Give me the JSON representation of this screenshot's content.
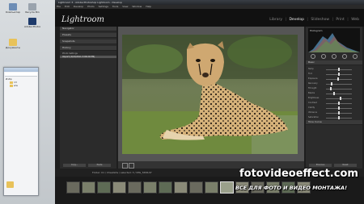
{
  "desktop": {
    "icons": [
      {
        "label": "Компьютер",
        "icon": "computer-icon"
      },
      {
        "label": "Recycle Bin",
        "icon": "recycle-bin-icon"
      },
      {
        "label": "Adobe Photoshop",
        "icon": "photoshop-icon"
      },
      {
        "label": "Документы",
        "icon": "documents-icon"
      }
    ]
  },
  "explorer": {
    "rows": [
      "Избр",
      "13",
      "ww"
    ]
  },
  "app": {
    "title_bar": "Lightroom 3 - Adobe Photoshop Lightroom - Develop",
    "menu": [
      "File",
      "Edit",
      "Develop",
      "Photo",
      "Settings",
      "Tools",
      "View",
      "Window",
      "Help"
    ],
    "logo": "Lightroom",
    "modules": [
      "Library",
      "Develop",
      "Slideshow",
      "Print",
      "Web"
    ],
    "active_module": "Develop",
    "left_panel": {
      "sections": [
        "Navigator",
        "Presets",
        "Snapshots",
        "History"
      ],
      "history_rows": [
        "Photo Settings",
        "Import (2/15/2011 3:09:29 PM)"
      ],
      "buttons": [
        "Copy...",
        "Paste"
      ]
    },
    "right_panel": {
      "histogram_label": "Histogram",
      "basic_label": "Basic",
      "sliders": [
        {
          "label": "Temp",
          "value": 0.5
        },
        {
          "label": "Tint",
          "value": 0.5
        },
        {
          "label": "Exposure",
          "value": 0.45
        },
        {
          "label": "Recovery",
          "value": 0.2
        },
        {
          "label": "Fill Light",
          "value": 0.15
        },
        {
          "label": "Blacks",
          "value": 0.3
        },
        {
          "label": "Brightness",
          "value": 0.55
        },
        {
          "label": "Contrast",
          "value": 0.5
        },
        {
          "label": "Clarity",
          "value": 0.5
        },
        {
          "label": "Vibrance",
          "value": 0.5
        },
        {
          "label": "Saturation",
          "value": 0.5
        }
      ],
      "tone_curve_label": "Tone Curve",
      "buttons": [
        "Previous",
        "Reset"
      ]
    },
    "filmstrip_info": "Folder: 01 / Cheetahs / selected: 3 / IMG_5656.tif",
    "thumb_count": 16,
    "selected_thumb": 10
  },
  "watermark": {
    "site": "fotovideoeffect.com",
    "slogan": "ВСЕ ДЛЯ ФОТО И ВИДЕО МОНТАЖА!"
  },
  "colors": {
    "accent": "#e8e8e8",
    "panel": "#2b2b2b",
    "folder": "#e8c25a"
  }
}
